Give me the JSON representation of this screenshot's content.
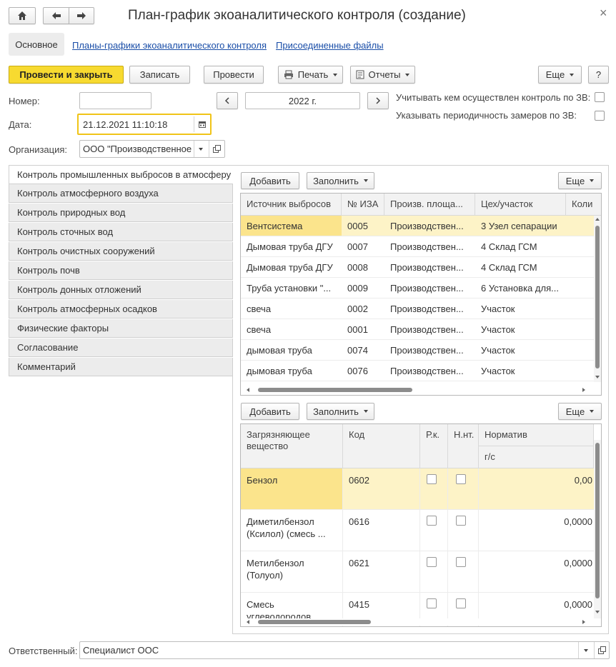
{
  "window": {
    "title": "План-график экоаналитического контроля (создание)",
    "close_glyph": "×",
    "home_icon": "home-icon",
    "back_icon": "arrow-left-icon",
    "forward_icon": "arrow-right-icon"
  },
  "nav_tabs": {
    "main": "Основное",
    "link1": "Планы-графики экоаналитического контроля",
    "link2": "Присоединенные файлы"
  },
  "toolbar": {
    "post_close": "Провести и закрыть",
    "save": "Записать",
    "post": "Провести",
    "print": "Печать",
    "reports": "Отчеты",
    "more": "Еще",
    "help": "?"
  },
  "form": {
    "number_label": "Номер:",
    "number_value": "",
    "date_label": "Дата:",
    "date_value": "21.12.2021 11:10:18",
    "org_label": "Организация:",
    "org_value": "ООО \"Производственное",
    "year_value": "2022 г.",
    "prev_glyph": "<",
    "next_glyph": ">",
    "check1_label": "Учитывать кем осуществлен контроль по ЗВ:",
    "check2_label": "Указывать периодичность замеров по ЗВ:",
    "responsible_label": "Ответственный:",
    "responsible_value": "Специалист ООС"
  },
  "side_tabs": [
    "Контроль промышленных выбросов в атмосферу",
    "Контроль атмосферного воздуха",
    "Контроль природных вод",
    "Контроль сточных вод",
    "Контроль очистных сооружений",
    "Контроль почв",
    "Контроль донных отложений",
    "Контроль атмосферных осадков",
    "Физические факторы",
    "Согласование",
    "Комментарий"
  ],
  "table1": {
    "add": "Добавить",
    "fill": "Заполнить",
    "more": "Еще",
    "headers": [
      "Источник выбросов",
      "№ ИЗА",
      "Произв. площа...",
      "Цех/участок",
      "Коли"
    ],
    "rows": [
      [
        "Вентсистема",
        "0005",
        "Производствен...",
        "3 Узел сепарации"
      ],
      [
        "Дымовая труба ДГУ",
        "0007",
        "Производствен...",
        "4 Склад ГСМ"
      ],
      [
        "Дымовая труба ДГУ",
        "0008",
        "Производствен...",
        "4 Склад ГСМ"
      ],
      [
        "Труба установки \"...",
        "0009",
        "Производствен...",
        "6 Установка для..."
      ],
      [
        "свеча",
        "0002",
        "Производствен...",
        "Участок"
      ],
      [
        "свеча",
        "0001",
        "Производствен...",
        "Участок"
      ],
      [
        "дымовая труба",
        "0074",
        "Производствен...",
        "Участок"
      ],
      [
        "дымовая труба",
        "0076",
        "Производствен...",
        "Участок"
      ]
    ]
  },
  "table2": {
    "add": "Добавить",
    "fill": "Заполнить",
    "more": "Еще",
    "headers": [
      "Загрязняющее\nвещество",
      "Код",
      "Р.к.",
      "Н.нт.",
      "Норматив",
      "г/с"
    ],
    "rows": [
      [
        "Бензол",
        "0602",
        "0,00"
      ],
      [
        "Диметилбензол\n(Ксилол) (смесь ...",
        "0616",
        "0,0000"
      ],
      [
        "Метилбензол\n(Толуол)",
        "0621",
        "0,0000"
      ],
      [
        "Смесь\nуглеводородов",
        "0415",
        "0,0000"
      ]
    ]
  }
}
